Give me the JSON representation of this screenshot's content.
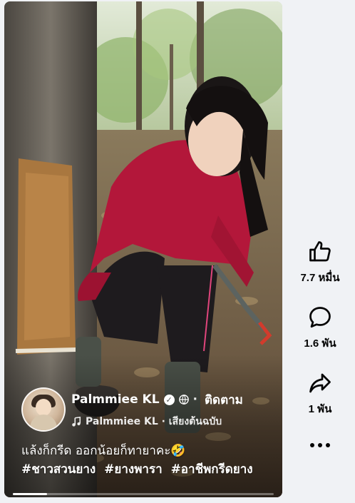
{
  "reel": {
    "author": {
      "name": "Palmmiee KL",
      "follow_label": "ติดตาม"
    },
    "audio": {
      "label": "Palmmiee KL · เสียงต้นฉบับ"
    },
    "caption": {
      "text": "แล้งก็กรีด ออกน้อยก็ทายาคะ🤣",
      "hashtags": [
        "#ชาวสวนยาง",
        "#ยางพารา",
        "#อาชีพกรีดยาง"
      ]
    },
    "progress_fraction": 0.13
  },
  "actions": {
    "like": {
      "icon": "thumbs-up-icon",
      "count": "7.7 หมื่น"
    },
    "comment": {
      "icon": "comment-bubble-icon",
      "count": "1.6 พัน"
    },
    "share": {
      "icon": "share-arrow-icon",
      "count": "1 พัน"
    },
    "more": {
      "icon": "more-dots-icon"
    }
  },
  "colors": {
    "page_bg": "#f0f2f5",
    "text_dark": "#050505",
    "overlay_text": "#ffffff",
    "shirt_red": "#b3173a"
  }
}
